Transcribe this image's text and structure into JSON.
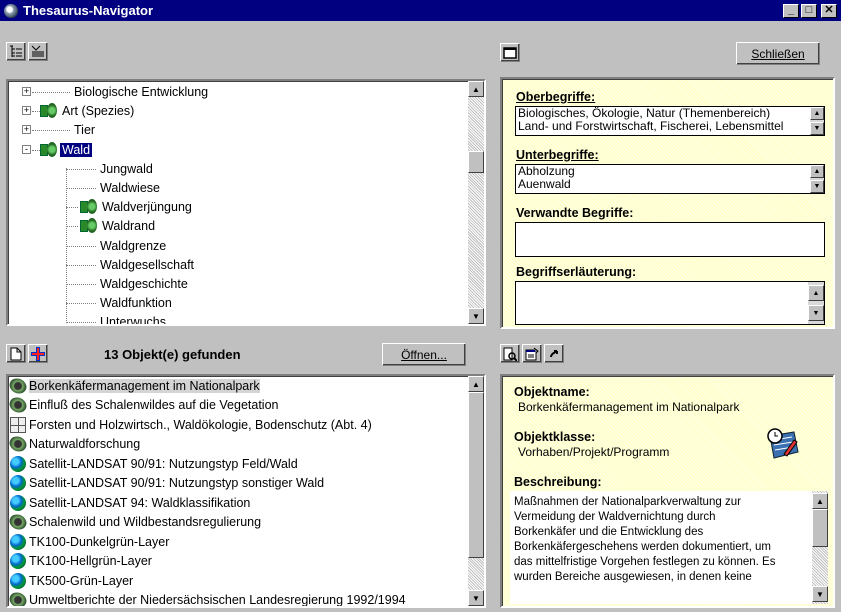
{
  "window": {
    "title": "Thesaurus-Navigator",
    "minimize_label": "_",
    "maximize_label": "□",
    "close_label": "✕"
  },
  "top_left": {
    "toolbar": {
      "tree_view_icon": "tree-view-icon",
      "list_view_icon": "list-view-icon"
    },
    "tree": [
      {
        "label": "Biologische Entwicklung",
        "expander": "+",
        "icon": false,
        "level": 1
      },
      {
        "label": "Art (Spezies)",
        "expander": "+",
        "icon": true,
        "level": 1
      },
      {
        "label": "Tier",
        "expander": "+",
        "icon": false,
        "level": 1
      },
      {
        "label": "Wald",
        "expander": "-",
        "icon": true,
        "level": 1,
        "selected": true
      },
      {
        "label": "Jungwald",
        "icon": false,
        "level": 2
      },
      {
        "label": "Waldwiese",
        "icon": false,
        "level": 2
      },
      {
        "label": "Waldverjüngung",
        "icon": true,
        "level": 2
      },
      {
        "label": "Waldrand",
        "icon": true,
        "level": 2
      },
      {
        "label": "Waldgrenze",
        "icon": false,
        "level": 2
      },
      {
        "label": "Waldgesellschaft",
        "icon": false,
        "level": 2
      },
      {
        "label": "Waldgeschichte",
        "icon": false,
        "level": 2
      },
      {
        "label": "Waldfunktion",
        "icon": false,
        "level": 2
      },
      {
        "label": "Unterwuchs",
        "icon": false,
        "level": 2
      }
    ]
  },
  "top_right": {
    "close_button": "Schließen",
    "broader_label": "Oberbegriffe:",
    "broader": [
      "Biologisches, Ökologie, Natur (Themenbereich)",
      "Land- und Forstwirtschaft, Fischerei, Lebensmittel"
    ],
    "narrower_label": "Unterbegriffe:",
    "narrower": [
      "Abholzung",
      "Auenwald"
    ],
    "related_label": "Verwandte Begriffe:",
    "related": "",
    "explanation_label": "Begriffserläuterung:",
    "explanation": ""
  },
  "bottom_left": {
    "result_count": "13 Objekt(e) gefunden",
    "open_button": "Öffnen...",
    "results": [
      {
        "label": "Borkenkäfermanagement im Nationalpark",
        "icon": "bug-icon",
        "selected": true
      },
      {
        "label": "Einfluß des Schalenwildes auf die Vegetation",
        "icon": "bug-icon"
      },
      {
        "label": "Forsten und Holzwirtsch., Waldökologie, Bodenschutz (Abt. 4)",
        "icon": "book-icon"
      },
      {
        "label": "Naturwaldforschung",
        "icon": "bug-icon"
      },
      {
        "label": "Satellit-LANDSAT 90/91: Nutzungstyp Feld/Wald",
        "icon": "earth-icon"
      },
      {
        "label": "Satellit-LANDSAT 90/91: Nutzungstyp sonstiger Wald",
        "icon": "earth-icon"
      },
      {
        "label": "Satellit-LANDSAT 94: Waldklassifikation",
        "icon": "earth-icon"
      },
      {
        "label": "Schalenwild und Wildbestandsregulierung",
        "icon": "bug-icon"
      },
      {
        "label": "TK100-Dunkelgrün-Layer",
        "icon": "earth-icon"
      },
      {
        "label": "TK100-Hellgrün-Layer",
        "icon": "earth-icon"
      },
      {
        "label": "TK500-Grün-Layer",
        "icon": "earth-icon"
      },
      {
        "label": "Umweltberichte der Niedersächsischen Landesregierung 1992/1994",
        "icon": "bug-icon"
      }
    ]
  },
  "bottom_right": {
    "object_name_label": "Objektname:",
    "object_name": "Borkenkäfermanagement im Nationalpark",
    "object_class_label": "Objektklasse:",
    "object_class": "Vorhaben/Projekt/Programm",
    "description_label": "Beschreibung:",
    "description": [
      "Maßnahmen der Nationalparkverwaltung zur",
      "Vermeidung der Waldvernichtung durch",
      "Borkenkäfer und die Entwicklung des",
      "Borkenkäfergeschehens werden dokumentiert, um",
      "das mittelfristige Vorgehen festlegen zu können. Es",
      "wurden Bereiche ausgewiesen, in denen keine"
    ]
  }
}
